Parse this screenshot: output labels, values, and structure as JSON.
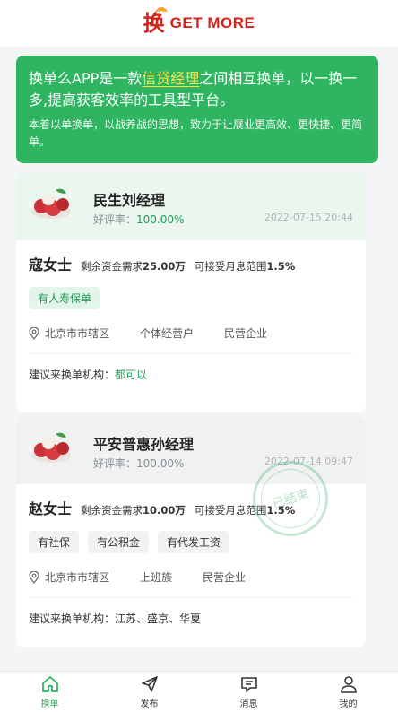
{
  "header": {
    "logo_mark": "换",
    "logo_text": "GET MORE"
  },
  "banner": {
    "lead_a": "换单么APP是一款",
    "lead_hl": "信贷经理",
    "lead_b": "之间相互换单，以一换一多,提高获客效率的工具型平台。",
    "sub": "本着以单换单，以战养战的思想，致力于让展业更高效、更快捷、更简单。",
    "accent": "#2fb562"
  },
  "cards": [
    {
      "manager": "民生刘经理",
      "rating_label": "好评率：",
      "rating_value": "100.00%",
      "date": "2022-07-15 20:44",
      "client": "寇女士",
      "need_prefix": "剩余资金需求",
      "need_amount": "25.00万",
      "rate_prefix": "可接受月息范围",
      "rate_value": "1.5%",
      "tags": [
        "有人寿保单"
      ],
      "location": "北京市市辖区",
      "job": "个体经营户",
      "company": "民营企业",
      "suggest_label": "建议来换单机构：",
      "suggest_value": "都可以"
    },
    {
      "manager": "平安普惠孙经理",
      "rating_label": "好评率：",
      "rating_value": "100.00%",
      "date": "2022-07-14 09:47",
      "client": "赵女士",
      "need_prefix": "剩余资金需求",
      "need_amount": "10.00万",
      "rate_prefix": "可接受月息范围",
      "rate_value": "1.5%",
      "tags": [
        "有社保",
        "有公积金",
        "有代发工资"
      ],
      "location": "北京市市辖区",
      "job": "上班族",
      "company": "民营企业",
      "suggest_label": "建议来换单机构：",
      "suggest_value": "江苏、盛京、华夏",
      "stamp": "已结束"
    }
  ],
  "nav": [
    {
      "label": "换单",
      "icon": "home-icon",
      "active": true
    },
    {
      "label": "发布",
      "icon": "send-icon",
      "active": false
    },
    {
      "label": "消息",
      "icon": "message-icon",
      "active": false
    },
    {
      "label": "我的",
      "icon": "user-icon",
      "active": false
    }
  ]
}
